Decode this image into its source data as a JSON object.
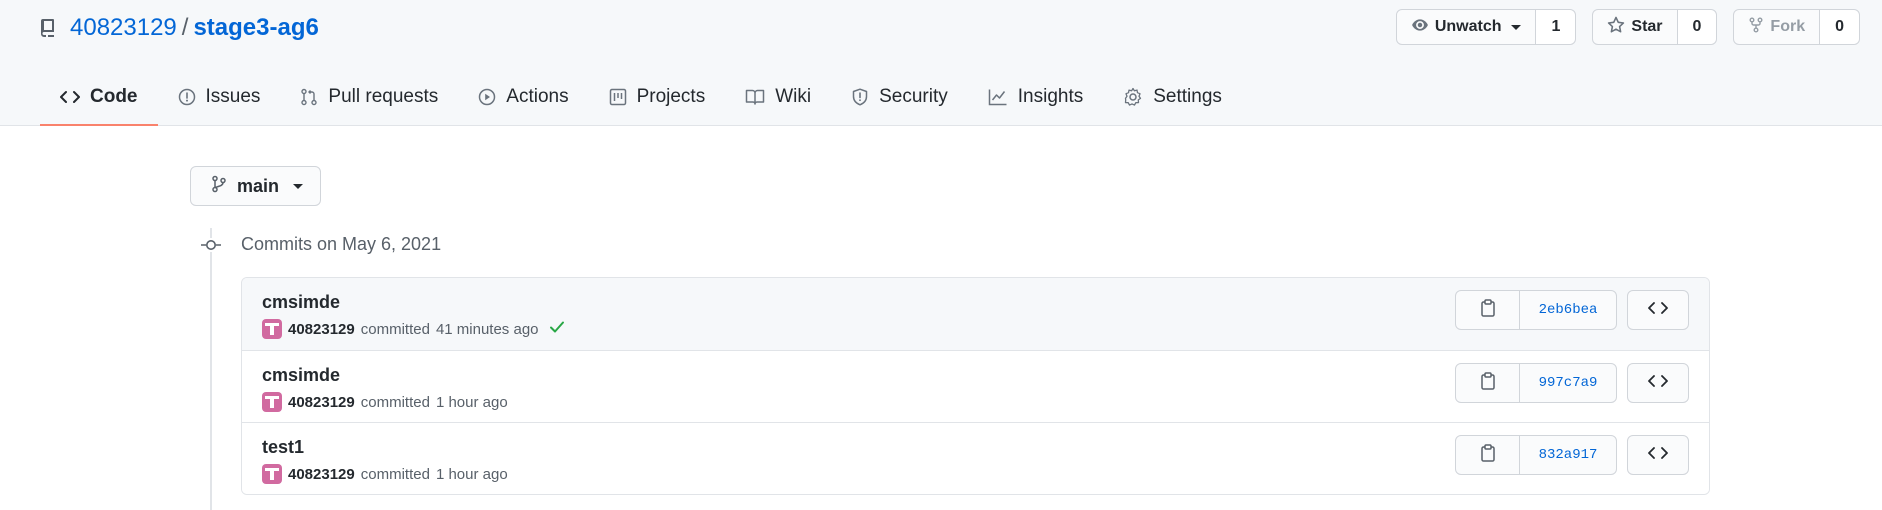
{
  "repo": {
    "owner": "40823129",
    "separator": "/",
    "name": "stage3-ag6"
  },
  "actions": {
    "watch": {
      "label": "Unwatch",
      "count": "1"
    },
    "star": {
      "label": "Star",
      "count": "0"
    },
    "fork": {
      "label": "Fork",
      "count": "0"
    }
  },
  "tabs": [
    {
      "label": "Code",
      "icon": "code-icon",
      "selected": true
    },
    {
      "label": "Issues",
      "icon": "issue-icon"
    },
    {
      "label": "Pull requests",
      "icon": "pull-request-icon"
    },
    {
      "label": "Actions",
      "icon": "play-icon"
    },
    {
      "label": "Projects",
      "icon": "project-icon"
    },
    {
      "label": "Wiki",
      "icon": "book-icon"
    },
    {
      "label": "Security",
      "icon": "shield-icon"
    },
    {
      "label": "Insights",
      "icon": "graph-icon"
    },
    {
      "label": "Settings",
      "icon": "gear-icon"
    }
  ],
  "branch": {
    "name": "main"
  },
  "commits_date": "Commits on May 6, 2021",
  "commits": [
    {
      "title": "cmsimde",
      "author": "40823129",
      "action": "committed",
      "time": "41 minutes ago",
      "status": "success",
      "sha": "2eb6bea"
    },
    {
      "title": "cmsimde",
      "author": "40823129",
      "action": "committed",
      "time": "1 hour ago",
      "sha": "997c7a9"
    },
    {
      "title": "test1",
      "author": "40823129",
      "action": "committed",
      "time": "1 hour ago",
      "sha": "832a917"
    }
  ],
  "colors": {
    "link": "#0366d6",
    "tab_underline": "#f9826c",
    "success": "#28a745",
    "avatar": "#d16aa0"
  }
}
